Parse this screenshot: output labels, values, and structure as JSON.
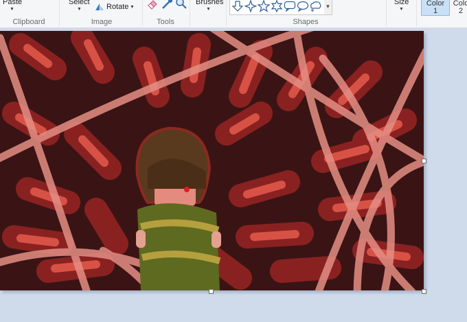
{
  "ribbon": {
    "clipboard": {
      "paste_label": "Paste",
      "group_label": "Clipboard"
    },
    "image": {
      "select_label": "Select",
      "rotate_label": "Rotate",
      "group_label": "Image"
    },
    "tools": {
      "group_label": "Tools",
      "icons": [
        "eraser-icon",
        "color-picker-icon",
        "magnifier-icon"
      ]
    },
    "brushes": {
      "label": "Brushes"
    },
    "shapes": {
      "group_label": "Shapes",
      "items": [
        "down-arrow-shape",
        "four-point-star-shape",
        "five-point-star-shape",
        "six-point-star-shape",
        "rounded-callout-shape",
        "oval-callout-shape",
        "cloud-callout-shape"
      ]
    },
    "size": {
      "label": "Size"
    },
    "color1": {
      "label_line1": "Color",
      "label_line2": "1"
    },
    "color2": {
      "label_line1": "Colo",
      "label_line2": "2"
    }
  },
  "colors": {
    "ribbon_bg": "#f5f6f7",
    "workspace_bg": "#cfdaea",
    "canvas_bg": "#3a1414",
    "accent_selected": "#c9e0f7"
  },
  "canvas": {
    "content": "digital painting: a dark-haired child in a green striped sweater standing among red and salmon brush strokes"
  }
}
